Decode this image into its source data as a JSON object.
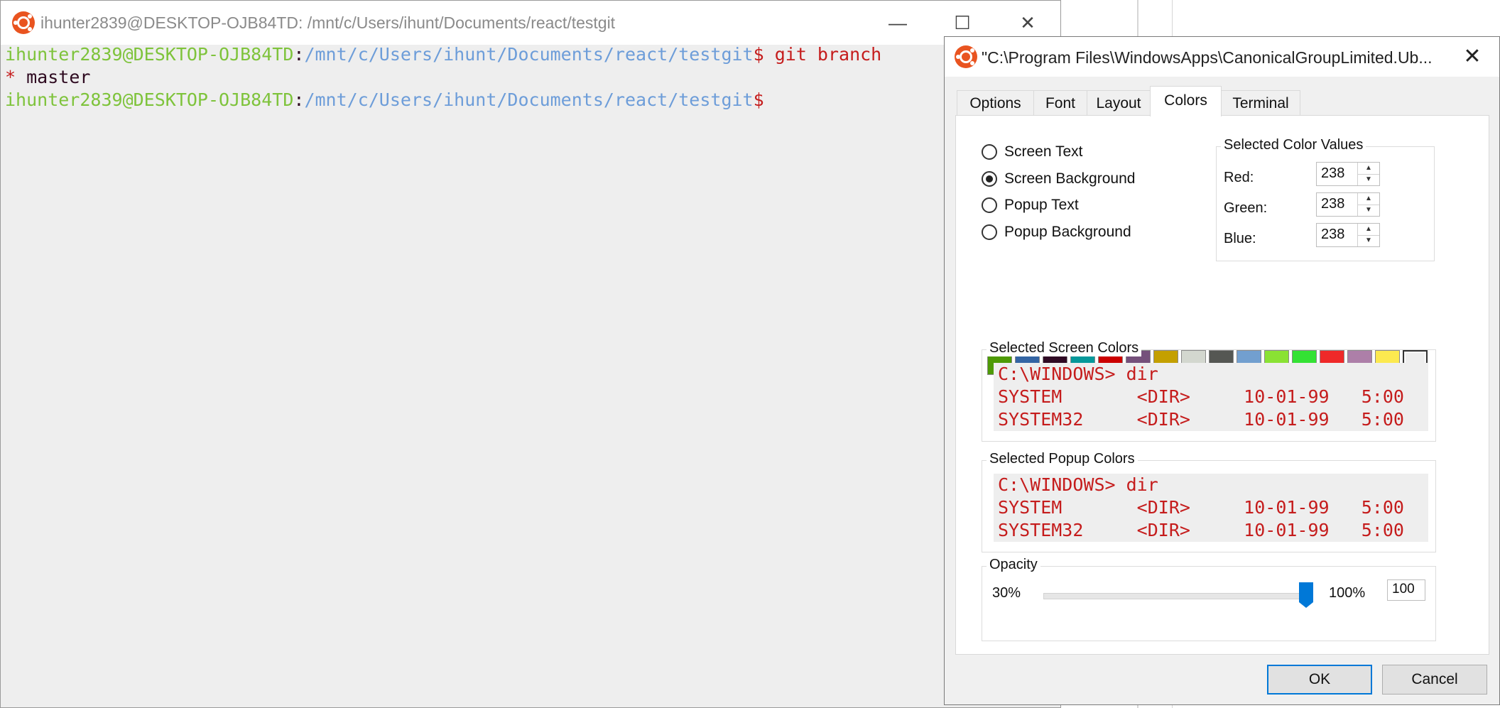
{
  "terminal": {
    "title": "ihunter2839@DESKTOP-OJB84TD: /mnt/c/Users/ihunt/Documents/react/testgit",
    "lines": [
      {
        "user": "ihunter2839@DESKTOP-OJB84TD",
        "sep": ":",
        "path": "/mnt/c/Users/ihunt/Documents/react/testgit",
        "prompt": "$ ",
        "cmd": "git branch"
      },
      {
        "star": "* ",
        "branch": "master"
      },
      {
        "user": "ihunter2839@DESKTOP-OJB84TD",
        "sep": ":",
        "path": "/mnt/c/Users/ihunt/Documents/react/testgit",
        "prompt": "$",
        "cmd": ""
      }
    ],
    "controls": {
      "minimize": "—",
      "maximize": "☐",
      "close": "✕"
    }
  },
  "dialog": {
    "title": "\"C:\\Program Files\\WindowsApps\\CanonicalGroupLimited.Ub...",
    "close": "✕",
    "tabs": [
      {
        "label": "Options"
      },
      {
        "label": "Font"
      },
      {
        "label": "Layout"
      },
      {
        "label": "Colors"
      },
      {
        "label": "Terminal"
      }
    ],
    "radios": [
      {
        "label": "Screen Text",
        "selected": false
      },
      {
        "label": "Screen Background",
        "selected": true
      },
      {
        "label": "Popup Text",
        "selected": false
      },
      {
        "label": "Popup Background",
        "selected": false
      }
    ],
    "selected_color_values": {
      "label": "Selected Color Values",
      "red_label": "Red:",
      "red": "238",
      "green_label": "Green:",
      "green": "238",
      "blue_label": "Blue:",
      "blue": "238"
    },
    "swatches": [
      "#4e9a06",
      "#3465a4",
      "#300a24",
      "#06989a",
      "#cc0000",
      "#75507b",
      "#c4a000",
      "#d3d7cf",
      "#555753",
      "#729fcf",
      "#8ae234",
      "#34e234",
      "#ef2929",
      "#ad7fa8",
      "#fce94f",
      "#eeeeee"
    ],
    "selected_swatch_index": 15,
    "screen_colors": {
      "label": "Selected Screen Colors",
      "lines": [
        "C:\\WINDOWS> dir",
        "SYSTEM       <DIR>     10-01-99   5:00",
        "SYSTEM32     <DIR>     10-01-99   5:00"
      ]
    },
    "popup_colors": {
      "label": "Selected Popup Colors",
      "lines": [
        "C:\\WINDOWS> dir",
        "SYSTEM       <DIR>     10-01-99   5:00",
        "SYSTEM32     <DIR>     10-01-99   5:00"
      ]
    },
    "opacity": {
      "label": "Opacity",
      "min_label": "30%",
      "max_label": "100%",
      "value": "100",
      "fraction": 1.0
    },
    "ok_label": "OK",
    "cancel_label": "Cancel"
  },
  "colors": {
    "prompt_user": "#7ec33b",
    "prompt_path": "#6d9dd9",
    "command": "#c51c1c",
    "ubuntu_orange": "#e95420",
    "accent_blue": "#0078d7"
  }
}
